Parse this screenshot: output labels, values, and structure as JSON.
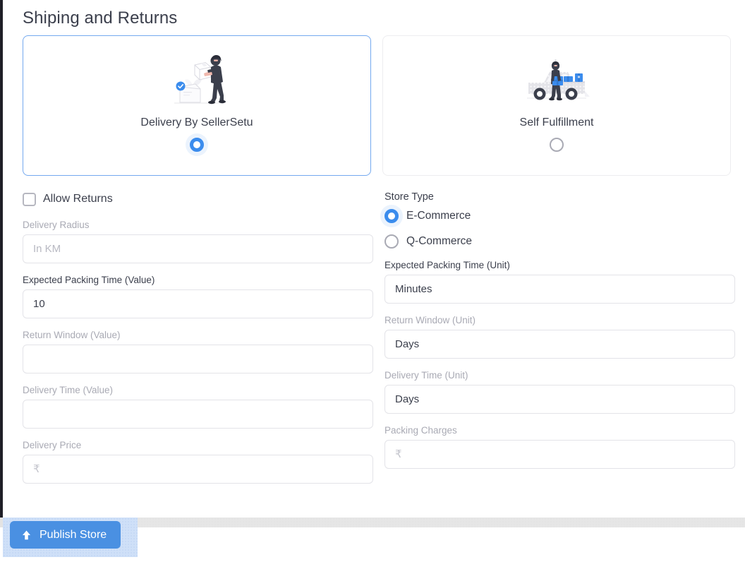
{
  "page": {
    "title": "Shiping and Returns"
  },
  "fulfillment": {
    "options": [
      {
        "label": "Delivery By SellerSetu",
        "icon": "person-carrying-box-illustration",
        "selected": true
      },
      {
        "label": "Self Fulfillment",
        "icon": "delivery-truck-illustration",
        "selected": false
      }
    ]
  },
  "allow_returns": {
    "label": "Allow Returns",
    "checked": false
  },
  "store_type": {
    "title": "Store Type",
    "options": [
      {
        "label": "E-Commerce",
        "selected": true
      },
      {
        "label": "Q-Commerce",
        "selected": false
      }
    ]
  },
  "fields": {
    "delivery_radius": {
      "label": "Delivery Radius",
      "value": "",
      "placeholder": "In KM",
      "disabled": true
    },
    "expected_packing_time_value": {
      "label": "Expected Packing Time (Value)",
      "value": "10",
      "placeholder": "",
      "disabled": false
    },
    "expected_packing_time_unit": {
      "label": "Expected Packing Time (Unit)",
      "value": "Minutes",
      "placeholder": "",
      "disabled": false
    },
    "return_window_value": {
      "label": "Return Window (Value)",
      "value": "",
      "placeholder": "",
      "disabled": true
    },
    "return_window_unit": {
      "label": "Return Window (Unit)",
      "value": "Days",
      "placeholder": "",
      "disabled": true
    },
    "delivery_time_value": {
      "label": "Delivery Time (Value)",
      "value": "",
      "placeholder": "",
      "disabled": true
    },
    "delivery_time_unit": {
      "label": "Delivery Time (Unit)",
      "value": "Days",
      "placeholder": "",
      "disabled": true
    },
    "delivery_price": {
      "label": "Delivery Price",
      "value": "",
      "placeholder": "₹",
      "disabled": true
    },
    "packing_charges": {
      "label": "Packing Charges",
      "value": "",
      "placeholder": "₹",
      "disabled": true
    }
  },
  "footer": {
    "publish_label": "Publish Store",
    "publish_icon": "upload-arrow-icon"
  },
  "colors": {
    "accent_blue": "#3b8ced",
    "button_blue": "#4a90e2",
    "selected_card_border": "#74a9ef",
    "text_dark": "#3b3f4c",
    "text_muted": "#a9aab4",
    "input_border": "#e3e3e8",
    "selection_highlight": "#cfe0f8"
  }
}
